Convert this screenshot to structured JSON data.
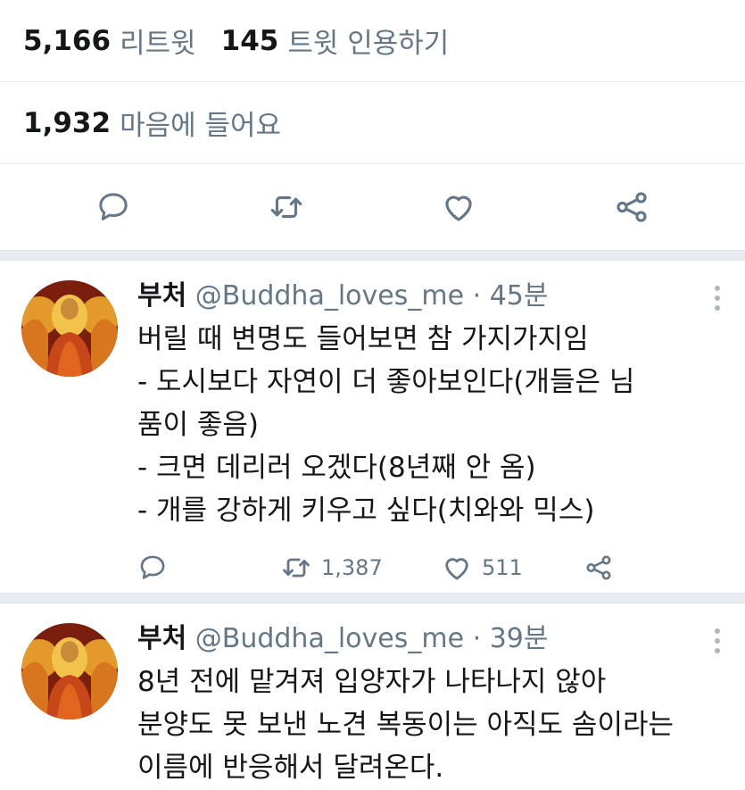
{
  "stats": {
    "retweets_count": "5,166",
    "retweets_label": "리트윗",
    "quotes_count": "145",
    "quotes_label": "트윗 인용하기",
    "likes_count": "1,932",
    "likes_label": "마음에 들어요"
  },
  "icons": {
    "reply": "reply-icon",
    "retweet": "retweet-icon",
    "like": "heart-icon",
    "share": "share-icon",
    "more": "more-vertical-icon",
    "accent": "#657786"
  },
  "tweets": [
    {
      "name": "부처",
      "handle": "@Buddha_loves_me",
      "separator": "·",
      "time": "45분",
      "lines": [
        "버릴 때 변명도 들어보면 참 가지가지임",
        "- 도시보다 자연이 더 좋아보인다(개들은 님",
        "품이 좋음)",
        "- 크면 데리러 오겠다(8년째 안 옴)",
        "- 개를 강하게 키우고 싶다(치와와 믹스)"
      ],
      "retweet_count": "1,387",
      "like_count": "511"
    },
    {
      "name": "부처",
      "handle": "@Buddha_loves_me",
      "separator": "·",
      "time": "39분",
      "lines": [
        "8년 전에 맡겨져 입양자가 나타나지 않아",
        "분양도 못 보낸 노견 복동이는 아직도 솜이라는",
        "이름에 반응해서 달려온다."
      ]
    }
  ]
}
